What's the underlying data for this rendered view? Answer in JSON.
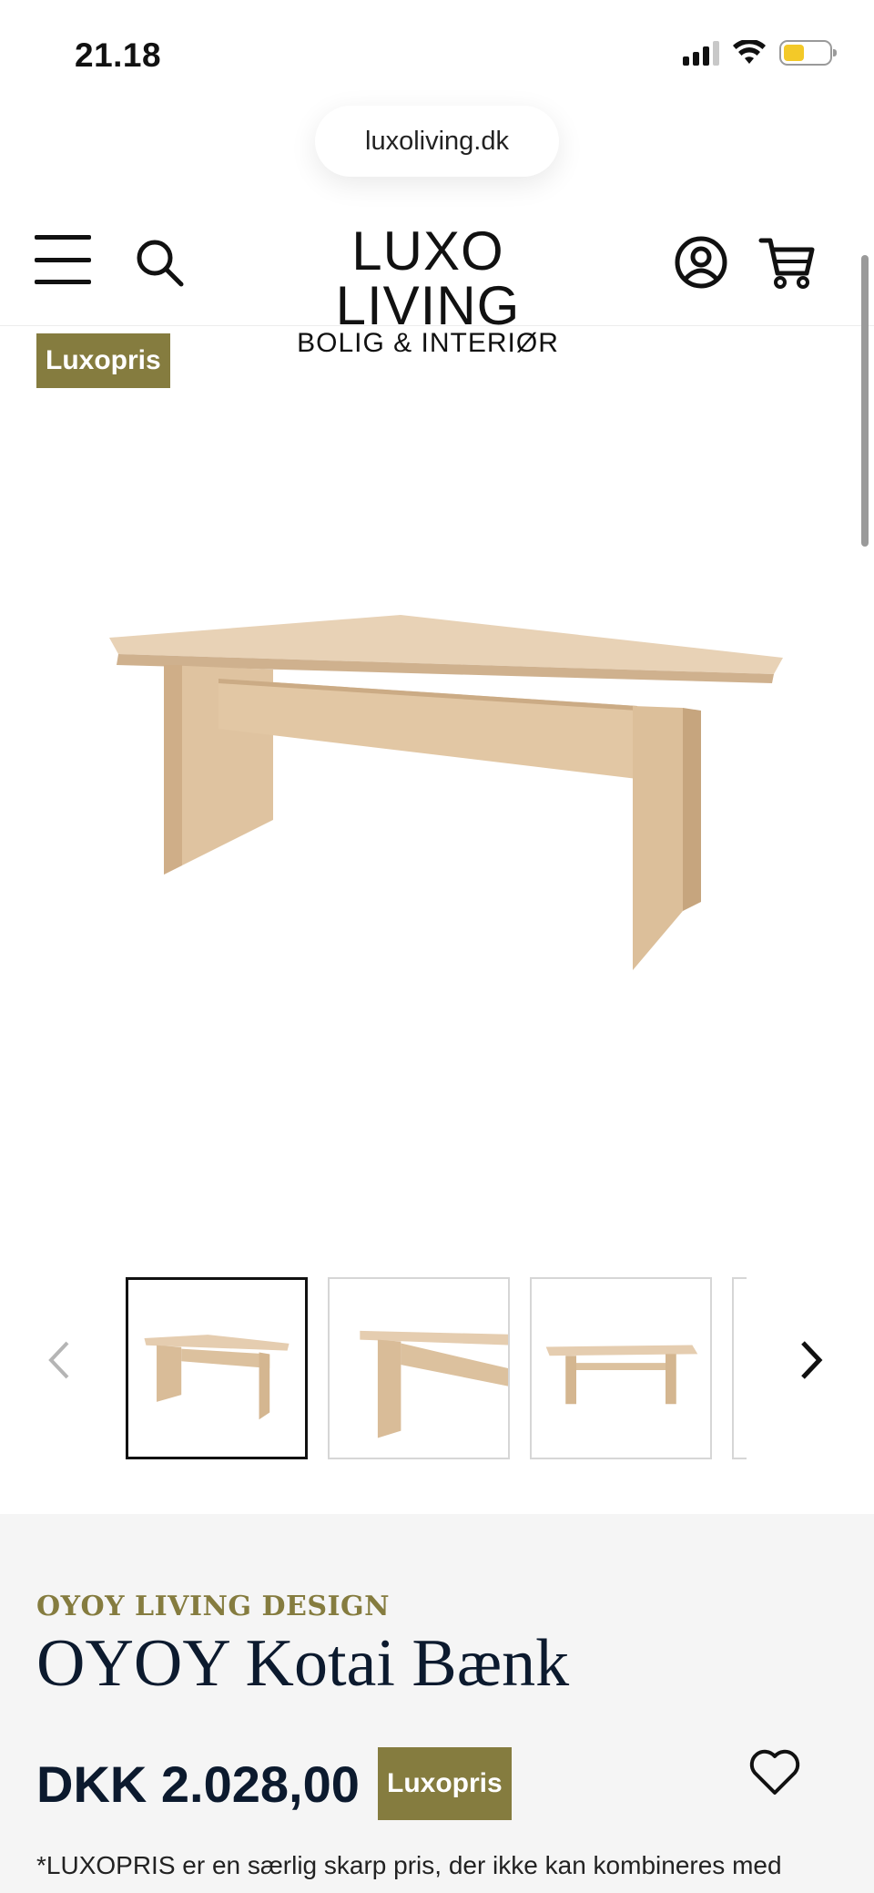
{
  "status_bar": {
    "time": "21.18",
    "battery_color": "#f3c928"
  },
  "browser": {
    "url": "luxoliving.dk"
  },
  "header": {
    "logo_line1": "LUXO LIVING",
    "logo_line2": "BOLIG & INTERIØR",
    "icons": [
      "menu-icon",
      "search-icon",
      "account-icon",
      "cart-icon"
    ]
  },
  "gallery": {
    "badge": "Luxopris",
    "thumbnails_count_visible": 4,
    "active_thumbnail": 1
  },
  "product": {
    "brand": "OYOY LIVING DESIGN",
    "title": "OYOY Kotai Bænk",
    "price": "DKK 2.028,00",
    "price_badge": "Luxopris",
    "note": "*LUXOPRIS er en særlig skarp pris, der ikke kan kombineres med"
  },
  "colors": {
    "accent": "#857c3f",
    "title": "#0c1a2e",
    "panel_bg": "#f5f5f5"
  }
}
